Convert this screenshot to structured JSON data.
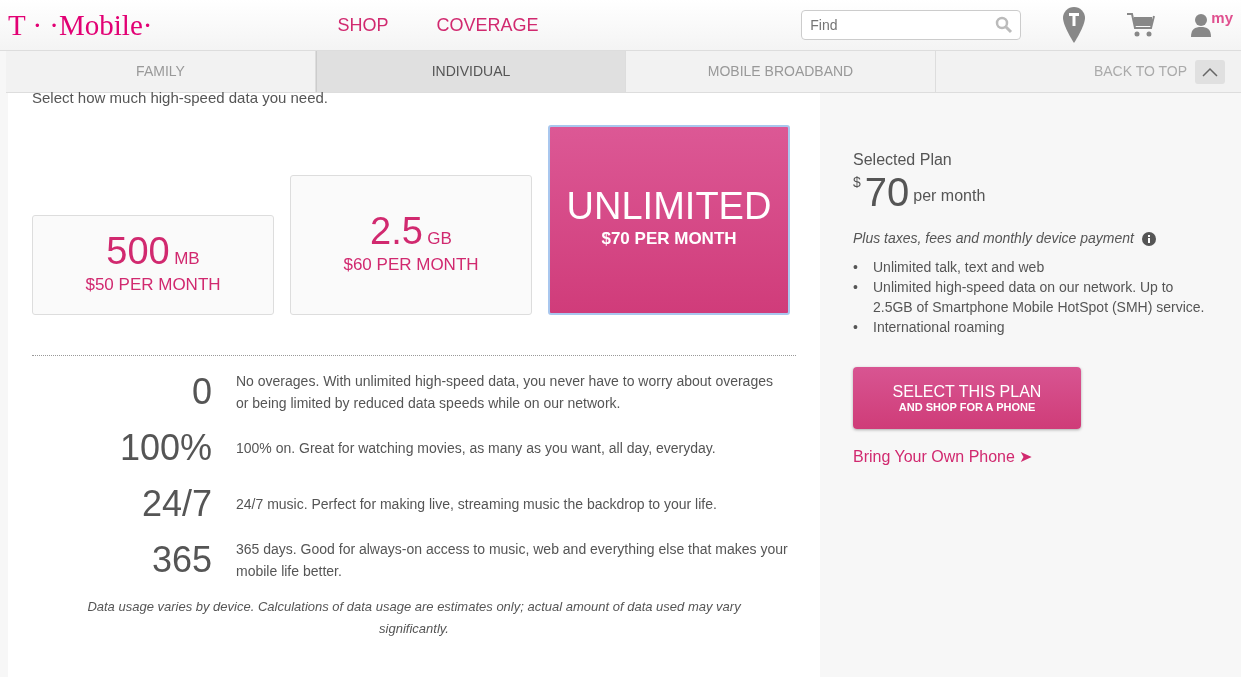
{
  "header": {
    "logo": "T · ·Mobile·",
    "nav": [
      "SHOP",
      "COVERAGE"
    ],
    "search": {
      "placeholder": "Find"
    },
    "account_label": "my"
  },
  "tabs": [
    {
      "label": "FAMILY",
      "selected": false
    },
    {
      "label": "INDIVIDUAL",
      "selected": true
    },
    {
      "label": "MOBILE BROADBAND",
      "selected": false
    }
  ],
  "back_to_top": "BACK TO TOP",
  "prompt": "Select how much high-speed data you need.",
  "plans": [
    {
      "amount": "500",
      "unit": "MB",
      "price": "$50 PER MONTH",
      "selected": false
    },
    {
      "amount": "2.5",
      "unit": "GB",
      "price": "$60 PER MONTH",
      "selected": false
    },
    {
      "amount": "UNLIMITED",
      "price": "$70 PER MONTH",
      "selected": true
    }
  ],
  "stats": [
    {
      "figure": "0",
      "text": "No overages. With unlimited high-speed data, you never have to worry about overages or being limited by reduced data speeds while on our network."
    },
    {
      "figure": "100%",
      "text": "100% on. Great for watching movies, as many as you want, all day, everyday."
    },
    {
      "figure": "24/7",
      "text": "24/7 music. Perfect for making live, streaming music the backdrop to your life."
    },
    {
      "figure": "365",
      "text": "365 days. Good for always-on access to music, web and everything else that makes your mobile life better."
    }
  ],
  "footnote": "Data usage varies by device. Calculations of data usage are estimates only; actual amount of data used may vary significantly.",
  "summary": {
    "heading": "Selected Plan",
    "currency": "$",
    "price": "70",
    "period": "per month",
    "note": "Plus taxes, fees and monthly device payment",
    "features": [
      {
        "bullet": "•",
        "text": "Unlimited talk, text and web"
      },
      {
        "bullet": "•",
        "text": "Unlimited high-speed data on our network. Up to 2.5GB of Smartphone Mobile HotSpot (SMH) service."
      },
      {
        "bullet": "•",
        "text": "International roaming"
      }
    ],
    "button": {
      "title": "SELECT THIS PLAN",
      "subtitle": "AND SHOP FOR A PHONE"
    },
    "link": "Bring Your Own Phone ➤"
  }
}
